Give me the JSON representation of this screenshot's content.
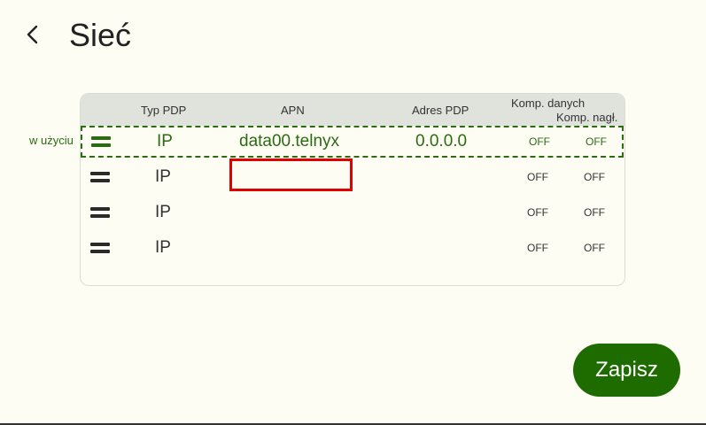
{
  "header": {
    "title": "Sieć",
    "back_icon": "chevron-left-icon"
  },
  "table": {
    "columns": {
      "pdp_type": "Typ PDP",
      "apn": "APN",
      "pdp_address": "Adres PDP",
      "data_compression": "Komp. danych",
      "header_compression": "Komp. nagł."
    },
    "in_use_label": "w użyciu",
    "rows": [
      {
        "pdp_type": "IP",
        "apn": "data00.telnyx",
        "pdp_address": "0.0.0.0",
        "data_compression": "OFF",
        "header_compression": "OFF",
        "in_use": true
      },
      {
        "pdp_type": "IP",
        "apn": "",
        "pdp_address": "",
        "data_compression": "OFF",
        "header_compression": "OFF",
        "in_use": false
      },
      {
        "pdp_type": "IP",
        "apn": "",
        "pdp_address": "",
        "data_compression": "OFF",
        "header_compression": "OFF",
        "in_use": false
      },
      {
        "pdp_type": "IP",
        "apn": "",
        "pdp_address": "",
        "data_compression": "OFF",
        "header_compression": "OFF",
        "in_use": false
      }
    ]
  },
  "apn_edit": {
    "value": ""
  },
  "actions": {
    "save_label": "Zapisz"
  },
  "colors": {
    "accent": "#1e6b00",
    "active_row": "#2b6b12",
    "highlight": "#e00000",
    "background": "#fdfdf4"
  }
}
